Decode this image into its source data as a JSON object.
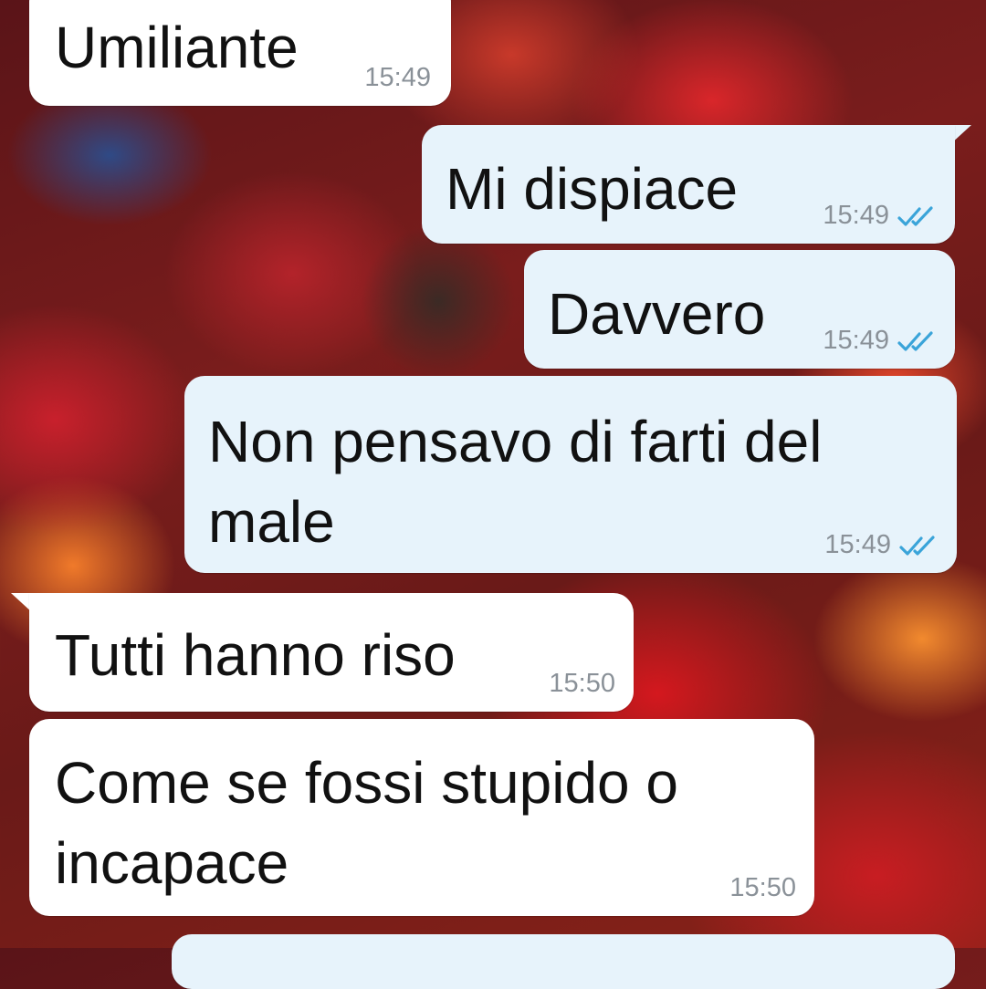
{
  "messages": [
    {
      "text": "Umiliante",
      "time": "15:49",
      "direction": "incoming"
    },
    {
      "text": "Mi dispiace",
      "time": "15:49",
      "direction": "outgoing",
      "status": "read"
    },
    {
      "text": "Davvero",
      "time": "15:49",
      "direction": "outgoing",
      "status": "read"
    },
    {
      "text": "Non pensavo di farti del\nmale",
      "time": "15:49",
      "direction": "outgoing",
      "status": "read"
    },
    {
      "text": "Tutti hanno riso",
      "time": "15:50",
      "direction": "incoming"
    },
    {
      "text": "Come se fossi stupido o\nincapace",
      "time": "15:50",
      "direction": "incoming"
    }
  ],
  "colors": {
    "incoming_bubble": "#ffffff",
    "outgoing_bubble": "#e7f3fb",
    "read_ticks": "#3aa4d9",
    "timestamp": "#8a9198"
  },
  "icons": {
    "read_receipt": "double-check-icon"
  }
}
